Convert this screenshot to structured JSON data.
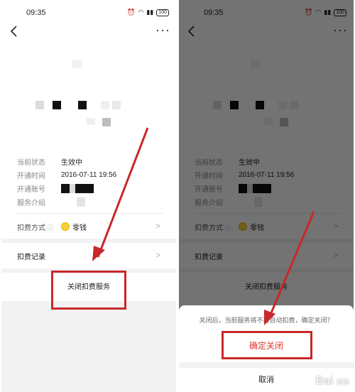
{
  "status_bar": {
    "time": "09:35",
    "battery": "100"
  },
  "details": {
    "status_label": "当前状态",
    "status_value": "生效中",
    "opened_label": "开通时间",
    "opened_value": "2016-07-11 19:56",
    "account_label": "开通账号",
    "intro_label": "服务介绍"
  },
  "payment": {
    "label": "扣费方式",
    "method": "零钱"
  },
  "records": {
    "label": "扣费记录"
  },
  "close_service": {
    "label": "关闭扣费服务"
  },
  "dialog": {
    "message": "关闭后，当前服务将不再自动扣费，确定关闭？",
    "confirm": "确定关闭",
    "cancel": "取消"
  },
  "watermark": {
    "text": "Bai",
    "sub": "经验"
  },
  "colors": {
    "highlight": "#c8282a",
    "confirm_text": "#e0352b",
    "coin": "#f5d23b"
  },
  "icons": [
    "back-arrow-icon",
    "more-dots-icon",
    "info-circle-icon",
    "chevron-right-icon",
    "coin-icon",
    "alarm-icon",
    "wifi-icon",
    "signal-icon",
    "battery-icon"
  ]
}
